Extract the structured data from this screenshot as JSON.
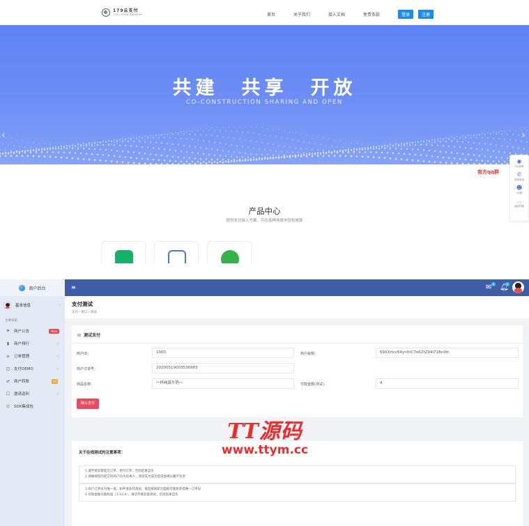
{
  "site": {
    "logo": {
      "cn": "179云支付",
      "en": "179 CLOUD PAYMENT"
    },
    "nav": {
      "links": [
        "首页",
        "关于我们",
        "接入文档",
        "免责条款"
      ],
      "login": "登录",
      "register": "注册"
    },
    "hero": {
      "title": "共建　共享　开放",
      "subtitle": "CO-CONSTRUCTION SHARING AND OPEN"
    },
    "float_bar": {
      "tip": "官方qq群",
      "items": [
        {
          "icon": "qq-icon",
          "label": "QQ咨询"
        },
        {
          "icon": "phone-icon",
          "label": "咨询电话"
        },
        {
          "icon": "qq-group-icon",
          "label": "QQ群"
        },
        {
          "icon": "back-to-top-icon",
          "label": "返回顶部"
        }
      ]
    },
    "products": {
      "title": "产品中心",
      "subtitle": "提供支付接入方案，可在各种场景中轻松收款"
    }
  },
  "admin": {
    "brand": "商户后台",
    "user": "基本信息",
    "section": "主要导航",
    "menu": [
      {
        "label": "商户公告",
        "icon": "speaker-icon",
        "badge": "New"
      },
      {
        "label": "商户排行",
        "icon": "bar-chart-icon",
        "chevron": "‹"
      },
      {
        "label": "订单管理",
        "icon": "list-icon",
        "chevron": "‹"
      },
      {
        "label": "支付DEMO",
        "icon": "pay-icon",
        "chevron": "‹"
      },
      {
        "label": "商户转账",
        "icon": "transfer-icon",
        "badge": "10"
      },
      {
        "label": "邀请返利",
        "icon": "invite-icon",
        "chevron": "‹"
      },
      {
        "label": "SDK集成包",
        "icon": "download-icon"
      }
    ],
    "topbar": {
      "mail_count": "0",
      "bell_count": "1"
    },
    "page": {
      "title": "支付测试",
      "breadcrumb": "支付 / 接口 / 测试"
    },
    "form": {
      "card_title": "测试支付",
      "merchant_id_label": "商户ID：",
      "merchant_id_value": "1000",
      "merchant_key_label": "商户秘钥：",
      "merchant_key_value": "69XXrtcc64ynlttC7e6ZtZ94i71Bn9tt",
      "order_no_label": "商户订单号：",
      "order_no_value": "20200519003536983",
      "product_label": "商品名称：",
      "product_value": "一杯纯真牛奶～",
      "amount_label": "付款金额(测试)：",
      "amount_value": "4",
      "submit": "确认支付"
    },
    "notice": {
      "title": "关于在线测试的注意事项：",
      "group1": [
        "1.请不要恶意提交订单、拒付订单，否则后果自负",
        "2.请确保您的提交的商户ID为您本人，测试支付成功后资金确认概不负责"
      ],
      "group2": [
        "3.商户订单号为唯一值，如申请多开测试，请直接刷新页面即可重新获得唯一订单号",
        "4.付款金额为随机值（1-10 ¥），请切不要恶意测试，否则后果自负"
      ]
    }
  },
  "watermark": {
    "main": "TT源码",
    "url": "www.ttym.cc"
  }
}
